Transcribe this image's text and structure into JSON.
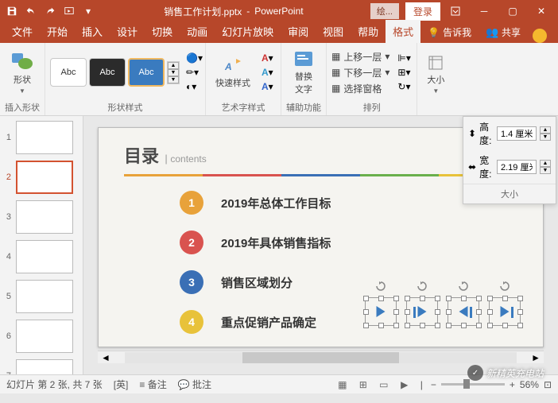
{
  "title": {
    "filename": "销售工作计划.pptx",
    "app": "PowerPoint",
    "drawingTools": "绘...",
    "login": "登录"
  },
  "tabs": {
    "file": "文件",
    "home": "开始",
    "insert": "插入",
    "design": "设计",
    "transitions": "切换",
    "animations": "动画",
    "slideshow": "幻灯片放映",
    "review": "审阅",
    "view": "视图",
    "help": "帮助",
    "format": "格式",
    "tellme": "告诉我",
    "share": "共享"
  },
  "ribbon": {
    "insertShapes": {
      "label": "插入形状",
      "shapes": "形状"
    },
    "shapeStyles": {
      "label": "形状样式",
      "abc": "Abc"
    },
    "quickStyles": {
      "label": "艺术字样式",
      "btn": "快速样式"
    },
    "altText": {
      "label": "辅助功能",
      "btn": "替换\n文字"
    },
    "arrange": {
      "label": "排列",
      "up": "上移一层",
      "down": "下移一层",
      "pane": "选择窗格"
    },
    "size": {
      "btn": "大小",
      "popup": "大小",
      "height": "高度:",
      "width": "宽度:",
      "heightVal": "1.4 厘米",
      "widthVal": "2.19 厘米"
    }
  },
  "slide": {
    "title": "目录",
    "subtitle": "contents",
    "items": [
      "2019年总体工作目标",
      "2019年具体销售指标",
      "销售区域划分",
      "重点促销产品确定"
    ],
    "colors": [
      "#e8a23a",
      "#d9534f",
      "#3a6fb5",
      "#e8c23a"
    ]
  },
  "thumbs": {
    "count": 7,
    "active": 2
  },
  "status": {
    "slideInfo": "幻灯片 第 2 张, 共 7 张",
    "lang": "英",
    "notes": "备注",
    "comments": "批注",
    "zoom": "56%"
  },
  "watermark": "新精英充电站"
}
